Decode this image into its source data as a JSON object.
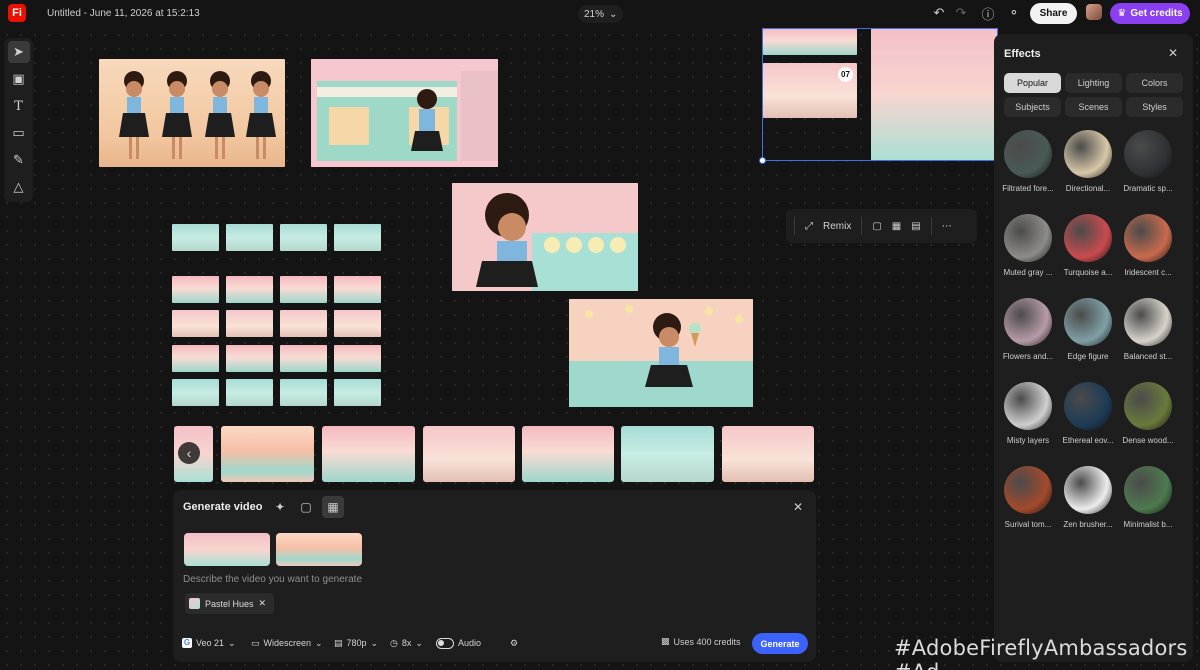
{
  "app": {
    "logo": "Fi",
    "doc_title": "Untitled - June 11, 2026 at 15:2:13",
    "zoom": "21%",
    "share_label": "Share",
    "credits_label": "Get credits"
  },
  "context_bar": {
    "remix_label": "Remix"
  },
  "selection_badge": "07",
  "effects": {
    "title": "Effects",
    "chips": [
      "Popular",
      "Lighting",
      "Colors",
      "Subjects",
      "Scenes",
      "Styles"
    ],
    "items": [
      {
        "label": "Filtrated fore...",
        "color": "#4a5a56"
      },
      {
        "label": "Directional...",
        "color": "#d8c7a8"
      },
      {
        "label": "Dramatic sp...",
        "color": "#2f3135"
      },
      {
        "label": "Muted gray ...",
        "color": "#8d8c88"
      },
      {
        "label": "Turquoise a...",
        "color": "#c94b4e"
      },
      {
        "label": "Iridescent c...",
        "color": "#c96a4d"
      },
      {
        "label": "Flowers and...",
        "color": "#b79aa8"
      },
      {
        "label": "Edge figure",
        "color": "#7fa0a6"
      },
      {
        "label": "Balanced st...",
        "color": "#d7d3cb"
      },
      {
        "label": "Misty layers",
        "color": "#cfcfcf"
      },
      {
        "label": "Ethereal eov...",
        "color": "#1d3b56"
      },
      {
        "label": "Dense wood...",
        "color": "#6a7a3b"
      },
      {
        "label": "Surival tom...",
        "color": "#a34a2c"
      },
      {
        "label": "Zen brusher...",
        "color": "#ededed"
      },
      {
        "label": "Minimalist b...",
        "color": "#4e7a4f"
      }
    ]
  },
  "generate": {
    "title": "Generate video",
    "prompt_placeholder": "Describe the video you want to generate",
    "tag": "Pastel Hues",
    "model": "Veo 21",
    "aspect": "Widescreen",
    "resolution": "780p",
    "duration": "8x",
    "audio": "Audio",
    "uses": "Uses 400 credits",
    "generate_label": "Generate"
  },
  "watermark": "#AdobeFireflyAmbassadors #Ad"
}
